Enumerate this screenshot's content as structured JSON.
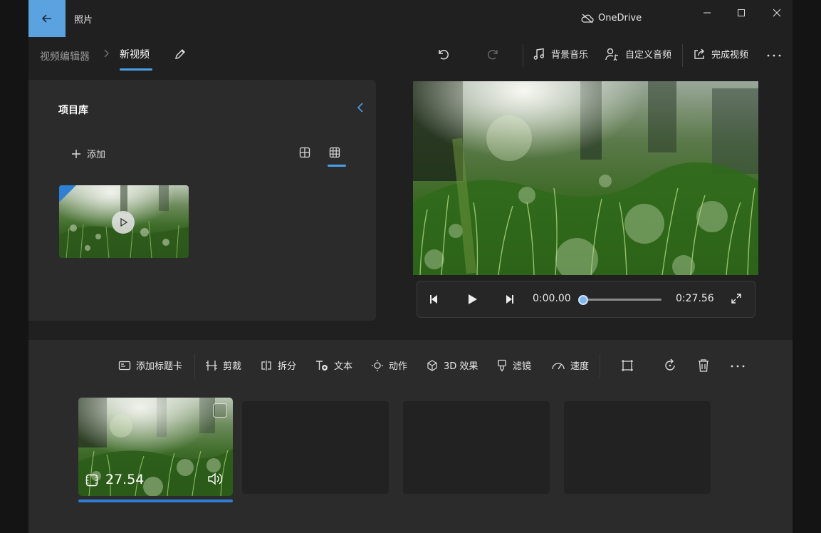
{
  "titlebar": {
    "app_title": "照片",
    "onedrive_label": "OneDrive"
  },
  "toolbar": {
    "breadcrumb_parent": "视频编辑器",
    "breadcrumb_current": "新视频",
    "background_music": "背景音乐",
    "custom_audio": "自定义音频",
    "finish_video": "完成视频"
  },
  "library": {
    "title": "项目库",
    "add_label": "添加"
  },
  "player": {
    "current_time": "0:00.00",
    "total_time": "0:27.56",
    "progress_fraction": 0.0
  },
  "storyboard": {
    "tools": {
      "add_title_card": "添加标题卡",
      "trim": "剪裁",
      "split": "拆分",
      "text": "文本",
      "motion": "动作",
      "effects_3d": "3D 效果",
      "filters": "滤镜",
      "speed": "速度"
    },
    "clip_duration": "27.54"
  },
  "colors": {
    "accent": "#2f7fd6",
    "back_button": "#5aa3e0",
    "panel": "#2b2b2b",
    "window": "#202020"
  }
}
